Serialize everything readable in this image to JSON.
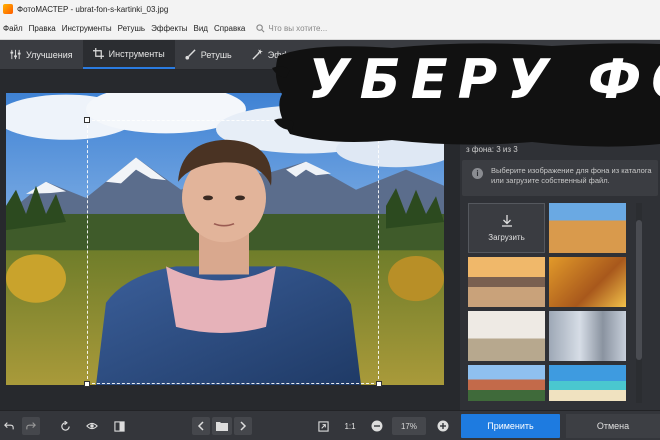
{
  "window": {
    "title": "ФотоМАСТЕР - ubrat-fon-s-kartinki_03.jpg"
  },
  "menu": {
    "items": [
      "Файл",
      "Правка",
      "Инструменты",
      "Ретушь",
      "Эффекты",
      "Вид",
      "Справка"
    ],
    "search_placeholder": "Что вы хотите..."
  },
  "toolbar": {
    "tabs": [
      {
        "label": "Улучшения",
        "icon": "sliders-icon"
      },
      {
        "label": "Инструменты",
        "icon": "crop-icon"
      },
      {
        "label": "Ретушь",
        "icon": "brush-icon"
      },
      {
        "label": "Эффе",
        "icon": "magic-wand-icon"
      }
    ],
    "active_tab": "Инструменты"
  },
  "side_panel": {
    "header": "з фона: 3 из 3",
    "info_text": "Выберите изображение для фона из каталога или загрузите собственный файл.",
    "upload_label": "Загрузить",
    "thumbnails": [
      "desert",
      "city-street",
      "autumn-forest",
      "interior",
      "street-buildings",
      "town-houses",
      "beach"
    ]
  },
  "bottom_bar": {
    "zoom_1to1": "1:1",
    "zoom_value": "17%",
    "apply_label": "Применить",
    "cancel_label": "Отмена"
  },
  "overlay": {
    "text": "УБЕРУ ФОН"
  },
  "colors": {
    "accent": "#1e7be0",
    "panel": "#2f3136",
    "toolbar": "#3a3c41"
  }
}
